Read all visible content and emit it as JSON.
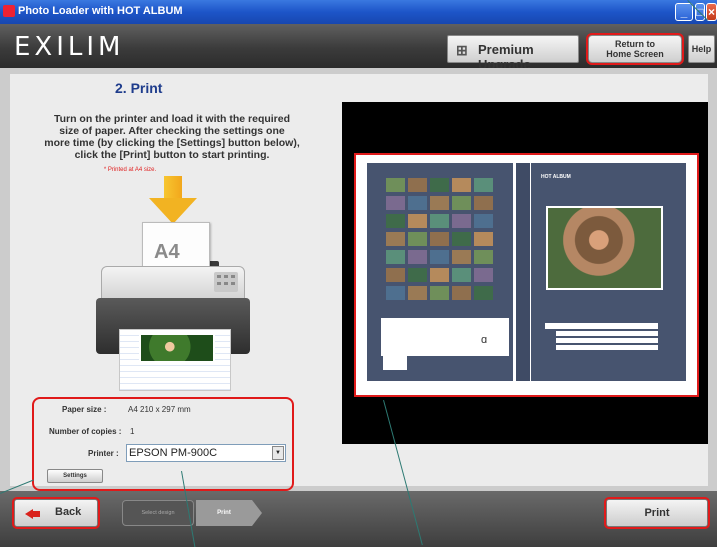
{
  "window": {
    "title": "Photo Loader with HOT ALBUM"
  },
  "header": {
    "logo": "EXILIM",
    "premium_label": "Premium Upgrade",
    "return_line1": "Return to",
    "return_line2": "Home Screen",
    "help_label": "Help"
  },
  "step": {
    "title": "2. Print"
  },
  "instructions": {
    "line1": "Turn on the printer and load it with the required",
    "line2": "size of paper. After checking the settings one",
    "line3": "more time (by clicking the [Settings] button below),",
    "line4": "click the [Print] button to start printing.",
    "note": "* Printed at A4 size.",
    "paper_graphic": "A4"
  },
  "settings": {
    "paper_size_label": "Paper size :",
    "paper_size_value": "A4 210 x 297 mm",
    "copies_label": "Number of copies :",
    "copies_value": "1",
    "printer_label": "Printer :",
    "printer_value": "EPSON PM-900C",
    "settings_button": "Settings"
  },
  "preview": {
    "brand": "HOT ALBUM"
  },
  "footer": {
    "back_label": "Back",
    "crumb_step1": "Select design",
    "crumb_step2": "Print",
    "print_label": "Print"
  },
  "colors": {
    "accent": "#e01a1a",
    "title_blue": "#1e3c8c",
    "album_blue": "#47546f"
  }
}
